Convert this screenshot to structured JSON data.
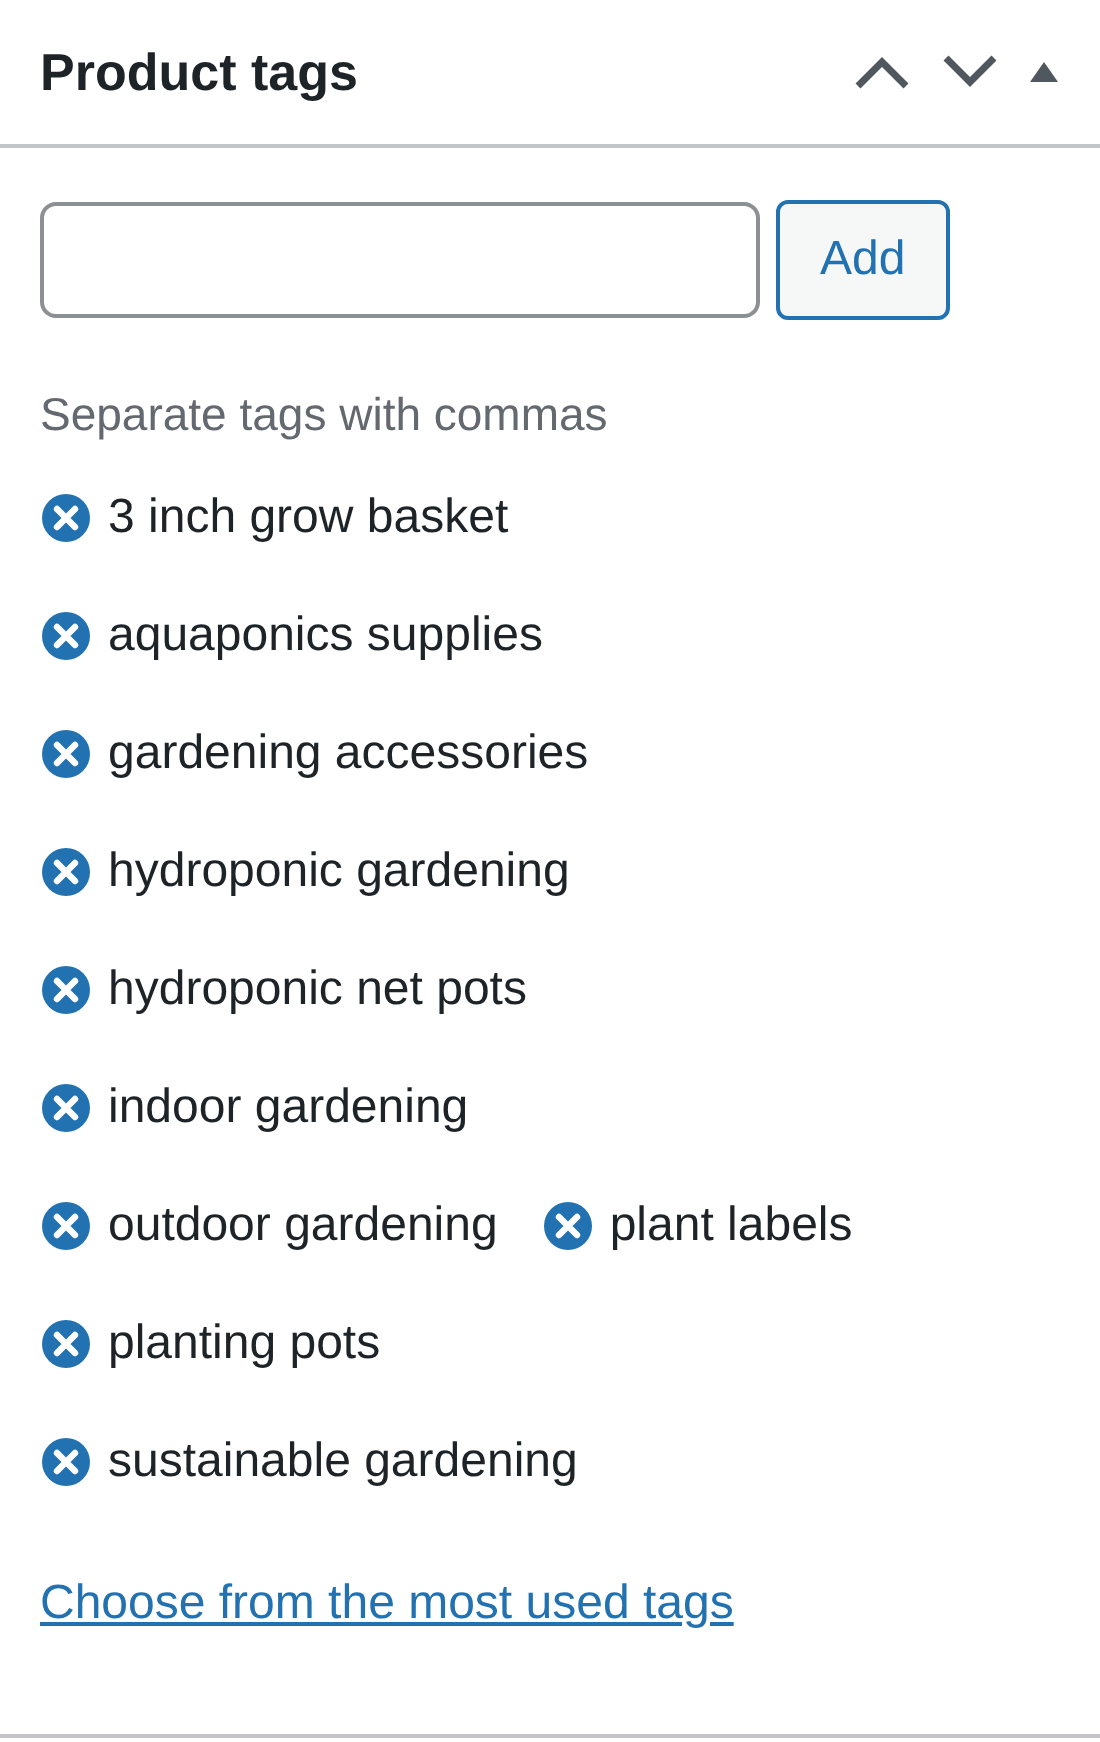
{
  "panel": {
    "title": "Product tags"
  },
  "add_button": {
    "label": "Add"
  },
  "hint": "Separate tags with commas",
  "tag_lines": [
    {
      "tags": [
        "3 inch grow basket"
      ]
    },
    {
      "tags": [
        "aquaponics supplies"
      ]
    },
    {
      "tags": [
        "gardening accessories"
      ]
    },
    {
      "tags": [
        "hydroponic gardening"
      ]
    },
    {
      "tags": [
        "hydroponic net pots"
      ]
    },
    {
      "tags": [
        "indoor gardening"
      ]
    },
    {
      "tags": [
        "outdoor gardening",
        "plant labels"
      ]
    },
    {
      "tags": [
        "planting pots"
      ]
    },
    {
      "tags": [
        "sustainable gardening"
      ]
    }
  ],
  "most_used_link": "Choose from the most used tags"
}
